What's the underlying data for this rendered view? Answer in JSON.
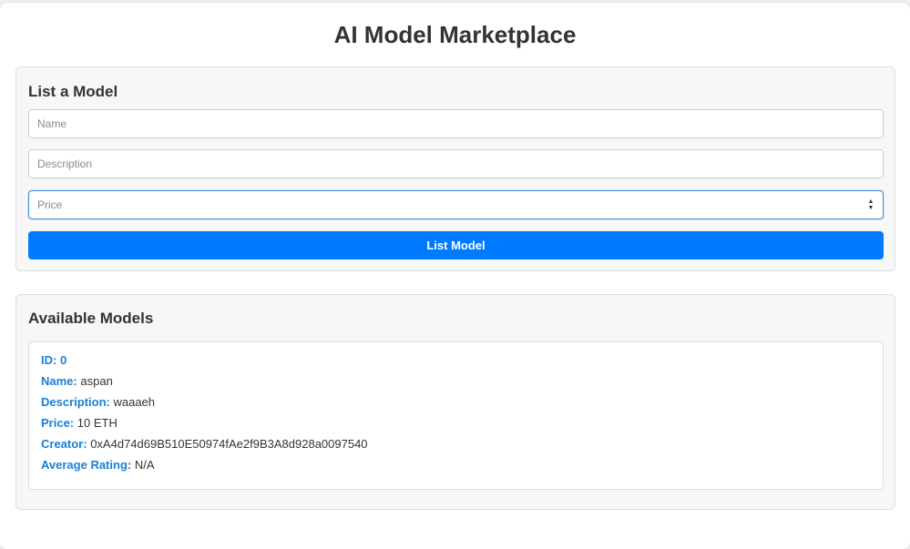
{
  "page": {
    "title": "AI Model Marketplace"
  },
  "list_form": {
    "heading": "List a Model",
    "name_placeholder": "Name",
    "description_placeholder": "Description",
    "price_placeholder": "Price",
    "submit_label": "List Model"
  },
  "available": {
    "heading": "Available Models",
    "models": [
      {
        "id_label": "ID:",
        "id": "0",
        "name_label": "Name:",
        "name": "aspan",
        "description_label": "Description:",
        "description": "waaaeh",
        "price_label": "Price:",
        "price": "10 ETH",
        "creator_label": "Creator:",
        "creator": "0xA4d74d69B510E50974fAe2f9B3A8d928a0097540",
        "rating_label": "Average Rating:",
        "rating": "N/A"
      }
    ]
  },
  "colors": {
    "accent": "#007bff",
    "label_blue": "#1a7fd6",
    "panel_bg": "#f7f7f7",
    "focus_border": "#3b8dd6"
  },
  "icons": {
    "price_spinner": "spinner-arrows-icon"
  }
}
